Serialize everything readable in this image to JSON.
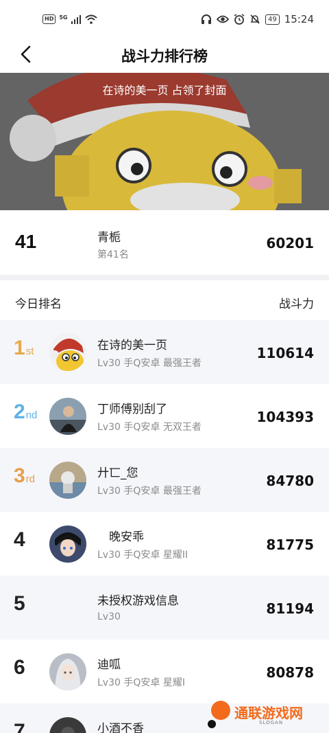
{
  "status_bar": {
    "hd": "HD",
    "network": "5G",
    "battery": "49",
    "time": "15:24"
  },
  "header": {
    "title": "战斗力排行榜"
  },
  "cover": {
    "caption": "在诗的美一页 占领了封面"
  },
  "my_rank": {
    "rank": "41",
    "name": "青栀",
    "sub": "第41名",
    "power": "60201"
  },
  "list_header": {
    "left": "今日排名",
    "right": "战斗力"
  },
  "colors": {
    "gold": "#e8a84a",
    "silver": "#5fb3e8",
    "bronze": "#e3a04d",
    "alt_row": "#f5f6fa",
    "watermark": "#f26b1d"
  },
  "rows": [
    {
      "rank": "1",
      "suffix": "st",
      "name": "在诗的美一页",
      "sub": "Lv30 手Q安卓 最强王者",
      "power": "110614"
    },
    {
      "rank": "2",
      "suffix": "nd",
      "name": "丁师傅别刮了",
      "sub": "Lv30 手Q安卓 无双王者",
      "power": "104393"
    },
    {
      "rank": "3",
      "suffix": "rd",
      "name": "廾匸_您",
      "sub": "Lv30 手Q安卓 最强王者",
      "power": "84780"
    },
    {
      "rank": "4",
      "suffix": "",
      "name": "　晚安乖",
      "sub": "Lv30 手Q安卓 星耀II",
      "power": "81775"
    },
    {
      "rank": "5",
      "suffix": "",
      "name": "未授权游戏信息",
      "sub": "Lv30",
      "power": "81194"
    },
    {
      "rank": "6",
      "suffix": "",
      "name": "迪呱",
      "sub": "Lv30 手Q安卓 星耀I",
      "power": "80878"
    },
    {
      "rank": "7",
      "suffix": "",
      "name": "小酒不香",
      "sub": "",
      "power": ""
    }
  ],
  "watermark": {
    "text": "通联游戏网",
    "slogan": "SLOGAN"
  }
}
